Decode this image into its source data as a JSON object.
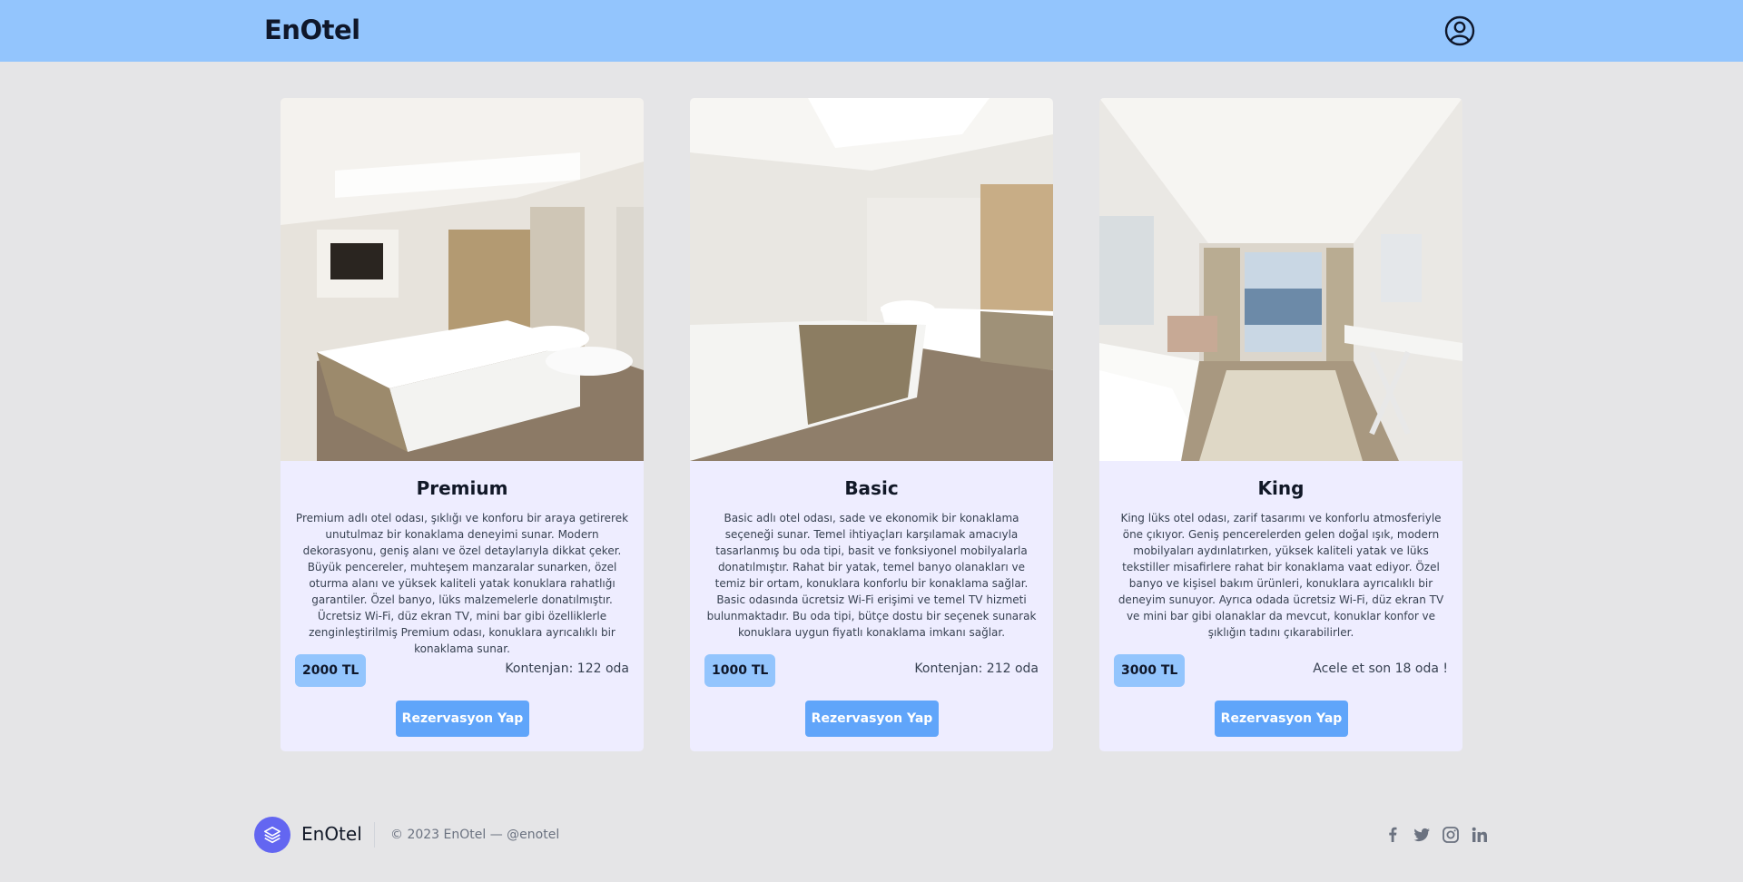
{
  "header": {
    "brand": "EnOtel",
    "user_icon": "user-circle-icon"
  },
  "rooms": [
    {
      "name": "Premium",
      "description": "Premium adlı otel odası, şıklığı ve konforu bir araya getirerek unutulmaz bir konaklama deneyimi sunar. Modern dekorasyonu, geniş alanı ve özel detaylarıyla dikkat çeker. Büyük pencereler, muhteşem manzaralar sunarken, özel oturma alanı ve yüksek kaliteli yatak konuklara rahatlığı garantiler. Özel banyo, lüks malzemelerle donatılmıştır. Ücretsiz Wi-Fi, düz ekran TV, mini bar gibi özelliklerle zenginleştirilmiş Premium odası, konuklara ayrıcalıklı bir konaklama sunar.",
      "price": "2000 TL",
      "capacity": "Kontenjan: 122 oda",
      "button": "Rezervasyon Yap"
    },
    {
      "name": "Basic",
      "description": "Basic adlı otel odası, sade ve ekonomik bir konaklama seçeneği sunar. Temel ihtiyaçları karşılamak amacıyla tasarlanmış bu oda tipi, basit ve fonksiyonel mobilyalarla donatılmıştır. Rahat bir yatak, temel banyo olanakları ve temiz bir ortam, konuklara konforlu bir konaklama sağlar. Basic odasında ücretsiz Wi-Fi erişimi ve temel TV hizmeti bulunmaktadır. Bu oda tipi, bütçe dostu bir seçenek sunarak konuklara uygun fiyatlı konaklama imkanı sağlar.",
      "price": "1000 TL",
      "capacity": "Kontenjan: 212 oda",
      "button": "Rezervasyon Yap"
    },
    {
      "name": "King",
      "description": "King lüks otel odası, zarif tasarımı ve konforlu atmosferiyle öne çıkıyor. Geniş pencerelerden gelen doğal ışık, modern mobilyaları aydınlatırken, yüksek kaliteli yatak ve lüks tekstiller misafirlere rahat bir konaklama vaat ediyor. Özel banyo ve kişisel bakım ürünleri, konuklara ayrıcalıklı bir deneyim sunuyor. Ayrıca odada ücretsiz Wi-Fi, düz ekran TV ve mini bar gibi olanaklar da mevcut, konuklar konfor ve şıklığın tadını çıkarabilirler.",
      "price": "3000 TL",
      "capacity": "Acele et son 18 oda !",
      "button": "Rezervasyon Yap"
    }
  ],
  "footer": {
    "brand": "EnOtel",
    "copyright": "© 2023 EnOtel — @enotel",
    "logo_icon": "layers-icon",
    "socials": [
      "facebook-icon",
      "twitter-icon",
      "instagram-icon",
      "linkedin-icon"
    ]
  },
  "colors": {
    "header": "#93c5fd",
    "background": "#e5e5e7",
    "card": "#eeedff",
    "button": "#60a5fa",
    "badge": "#93c5fd",
    "footer_logo": "#6366f1"
  }
}
